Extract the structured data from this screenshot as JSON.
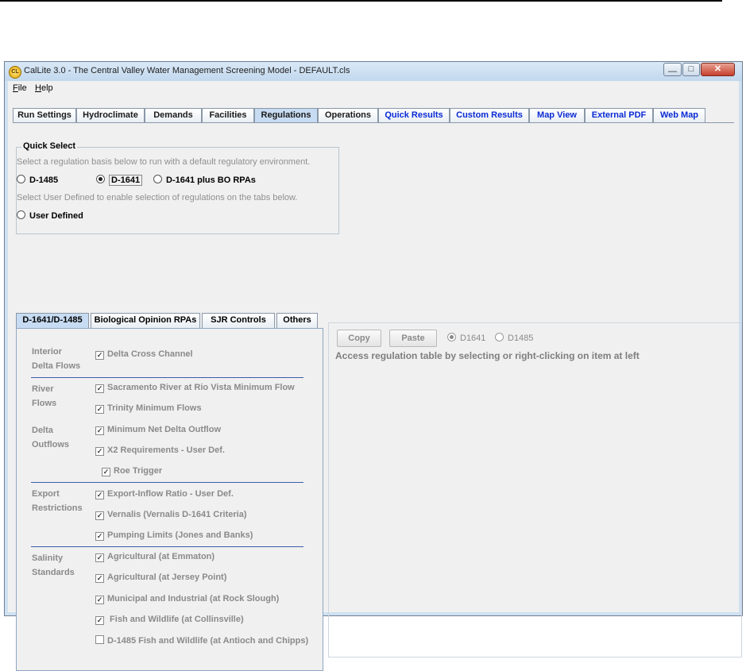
{
  "window": {
    "title": "CalLite 3.0 -  The Central Valley Water Management Screening Model - DEFAULT.cls",
    "app_icon_text": "CL",
    "controls": {
      "minimize": "—",
      "maximize": "□",
      "close": "✕"
    }
  },
  "menu": {
    "file_first": "F",
    "file_rest": "ile",
    "help_first": "H",
    "help_rest": "elp"
  },
  "tabs": [
    {
      "label": "Run Settings"
    },
    {
      "label": "Hydroclimate"
    },
    {
      "label": "Demands"
    },
    {
      "label": "Facilities"
    },
    {
      "label": "Regulations"
    },
    {
      "label": "Operations"
    },
    {
      "label": "Quick Results"
    },
    {
      "label": "Custom Results"
    },
    {
      "label": "Map View"
    },
    {
      "label": "External PDF"
    },
    {
      "label": "Web Map"
    }
  ],
  "quick_select": {
    "legend": "Quick Select",
    "hint1": "Select a regulation basis below to run with a default regulatory environment.",
    "hint2": "Select User Defined to enable selection of regulations on the tabs below.",
    "options": [
      {
        "label": "D-1485",
        "selected": false
      },
      {
        "label": "D-1641",
        "selected": true
      },
      {
        "label": "D-1641 plus BO RPAs",
        "selected": false
      }
    ],
    "user_defined": "User Defined"
  },
  "subtabs": [
    {
      "label": "D-1641/D-1485"
    },
    {
      "label": "Biological Opinion RPAs"
    },
    {
      "label": "SJR Controls"
    },
    {
      "label": "Others"
    }
  ],
  "regulations": {
    "categories": {
      "interior": "Interior\nDelta Flows",
      "river": "River\nFlows",
      "delta": "Delta\nOutflows",
      "export": "Export\nRestrictions",
      "salinity": "Salinity\nStandards"
    },
    "items": [
      {
        "label": "Delta Cross Channel",
        "checked": true
      },
      {
        "label": "Sacramento River at Rio Vista Minimum Flow",
        "checked": true
      },
      {
        "label": "Trinity Minimum Flows",
        "checked": true
      },
      {
        "label": "Minimum Net Delta Outflow",
        "checked": true
      },
      {
        "label": "X2 Requirements - User Def.",
        "checked": true
      },
      {
        "label": "Roe Trigger",
        "checked": true
      },
      {
        "label": "Export-Inflow Ratio - User Def.",
        "checked": true
      },
      {
        "label": "Vernalis (Vernalis D-1641 Criteria)",
        "checked": true
      },
      {
        "label": "Pumping Limits (Jones and Banks)",
        "checked": true
      },
      {
        "label": "Agricultural (at Emmaton)",
        "checked": true
      },
      {
        "label": "Agricultural (at Jersey Point)",
        "checked": true
      },
      {
        "label": "Municipal and Industrial (at Rock Slough)",
        "checked": true
      },
      {
        "label": " Fish and Wildlife (at Collinsville)",
        "checked": true
      },
      {
        "label": "D-1485 Fish and Wildlife (at Antioch and Chipps)",
        "checked": false
      }
    ]
  },
  "right_panel": {
    "copy": "Copy",
    "paste": "Paste",
    "opt_d1641": "D1641",
    "opt_d1485": "D1485",
    "d1641_selected": true,
    "access_text": "Access regulation table by selecting or right-clicking on item at left"
  }
}
